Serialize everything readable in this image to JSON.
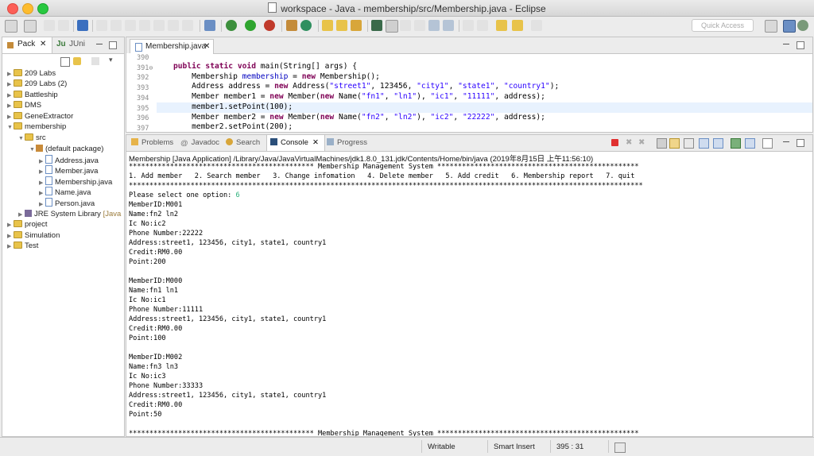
{
  "window": {
    "title": "workspace - Java - membership/src/Membership.java - Eclipse"
  },
  "toolbar": {
    "quick_access_placeholder": "Quick Access"
  },
  "left_pane": {
    "tabs": [
      {
        "label": "Pack"
      },
      {
        "label": "JUni"
      }
    ],
    "tree": [
      {
        "label": "209 Labs"
      },
      {
        "label": "209 Labs (2)"
      },
      {
        "label": "Battleship"
      },
      {
        "label": "DMS"
      },
      {
        "label": "GeneExtractor"
      },
      {
        "label": "membership"
      },
      {
        "label": "src"
      },
      {
        "label": "(default package)"
      },
      {
        "label": "Address.java"
      },
      {
        "label": "Member.java"
      },
      {
        "label": "Membership.java"
      },
      {
        "label": "Name.java"
      },
      {
        "label": "Person.java"
      },
      {
        "label": "JRE System Library",
        "suffix": "[Java"
      },
      {
        "label": "project"
      },
      {
        "label": "Simulation"
      },
      {
        "label": "Test"
      }
    ]
  },
  "editor": {
    "tab_label": "Membership.java",
    "line_numbers": [
      "390",
      "391⊖",
      "392",
      "393",
      "394",
      "395",
      "396",
      "397"
    ]
  },
  "console": {
    "tabs": [
      {
        "label": "Problems"
      },
      {
        "label": "Javadoc"
      },
      {
        "label": "Search"
      },
      {
        "label": "Console"
      },
      {
        "label": "Progress"
      }
    ],
    "description": "Membership [Java Application] /Library/Java/JavaVirtualMachines/jdk1.8.0_131.jdk/Contents/Home/bin/java (2019年8月15日 上午11:56:10)",
    "lines": [
      "********************************************* Membership Management System *************************************************",
      "1. Add member   2. Search member   3. Change infomation   4. Delete member   5. Add credit   6. Membership report   7. quit",
      "*****************************************************************************************************************************",
      "Please select one option: ",
      "MemberID:M001",
      "Name:fn2 ln2",
      "Ic No:ic2",
      "Phone Number:22222",
      "Address:street1, 123456, city1, state1, country1",
      "Credit:RM0.00",
      "Point:200",
      "",
      "MemberID:M000",
      "Name:fn1 ln1",
      "Ic No:ic1",
      "Phone Number:11111",
      "Address:street1, 123456, city1, state1, country1",
      "Credit:RM0.00",
      "Point:100",
      "",
      "MemberID:M002",
      "Name:fn3 ln3",
      "Ic No:ic3",
      "Phone Number:33333",
      "Address:street1, 123456, city1, state1, country1",
      "Credit:RM0.00",
      "Point:50",
      "",
      "********************************************* Membership Management System *************************************************"
    ],
    "user_input": "6"
  },
  "statusbar": {
    "writable": "Writable",
    "insert_mode": "Smart Insert",
    "position": "395 : 31"
  },
  "colors": {
    "keyword": "#7f0055",
    "string": "#2a00ff",
    "field": "#0000c0",
    "console_input": "#29b07a",
    "highlight_line": "#e8f2fe"
  }
}
